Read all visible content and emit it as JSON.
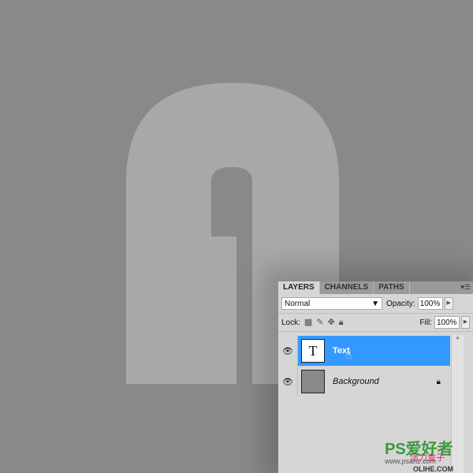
{
  "colors": {
    "background": "#898989",
    "letter": "#a8a8a8",
    "selection": "#3399ff"
  },
  "panel": {
    "tabs": [
      "LAYERS",
      "CHANNELS",
      "PATHS"
    ],
    "menu_icon": "panel-menu-icon",
    "blend_mode": "Normal",
    "opacity_label": "Opacity:",
    "opacity": "100%",
    "lock_label": "Lock:",
    "fill_label": "Fill:",
    "fill": "100%",
    "layers": [
      {
        "name": "Text",
        "thumb": "T",
        "selected": true
      },
      {
        "name": "Background",
        "locked": true
      }
    ]
  },
  "watermark": {
    "logo": "PS爱好者",
    "site": "www.psahz.com",
    "logo2": "活力盒子",
    "site2": "OLIHE.COM"
  }
}
